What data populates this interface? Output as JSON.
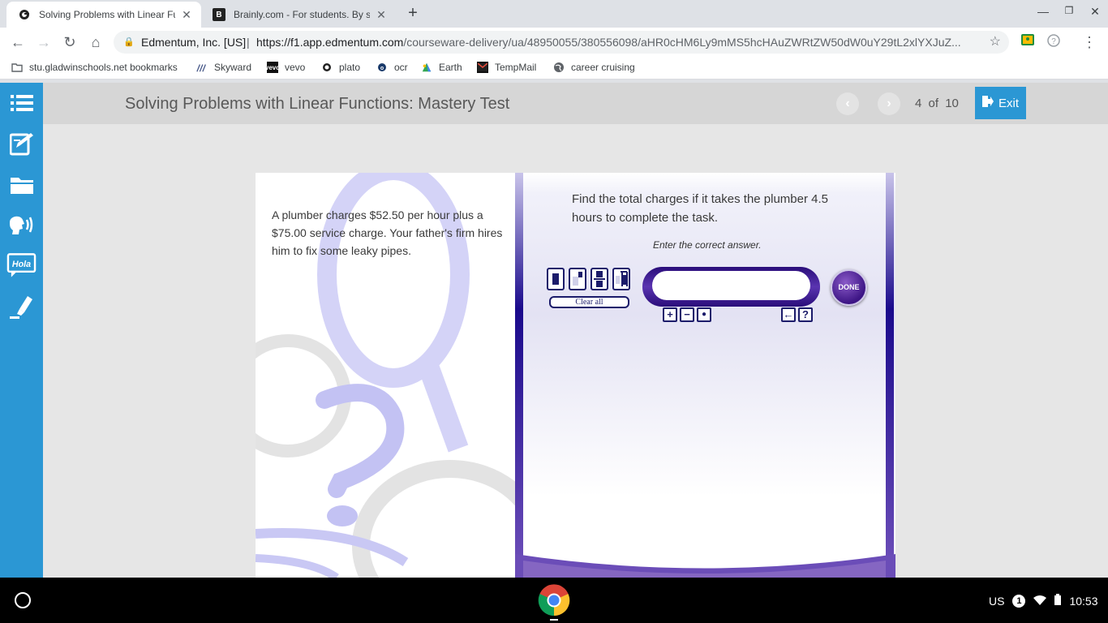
{
  "browser": {
    "tabs": [
      {
        "title": "Solving Problems with Linear Fu",
        "favicon": "edmentum-icon",
        "active": true
      },
      {
        "title": "Brainly.com - For students. By st",
        "favicon": "brainly-icon",
        "active": false
      }
    ],
    "address": {
      "site_name": "Edmentum, Inc. [US]",
      "separator": "|",
      "url_host": "https://f1.app.edmentum.com",
      "url_path": "/courseware-delivery/ua/48950055/380556098/aHR0cHM6Ly9mMS5hcHAuZWRtZW50dW0uY29tL2xlYXJuZ..."
    },
    "bookmarks": [
      {
        "label": "stu.gladwinschools.net bookmarks",
        "icon": "folder-icon"
      },
      {
        "label": "Skyward",
        "icon": "skyward-icon"
      },
      {
        "label": "vevo",
        "icon": "vevo-icon"
      },
      {
        "label": "plato",
        "icon": "edmentum-icon"
      },
      {
        "label": "ocr",
        "icon": "ocr-icon"
      },
      {
        "label": "Earth",
        "icon": "earth-icon"
      },
      {
        "label": "TempMail",
        "icon": "mail-icon"
      },
      {
        "label": "career cruising",
        "icon": "globe-icon"
      }
    ]
  },
  "app": {
    "title": "Solving Problems with Linear Functions: Mastery Test",
    "progress": {
      "current": "4",
      "of": "of",
      "total": "10"
    },
    "exit_label": "Exit",
    "sidebar": [
      "menu-icon",
      "notes-icon",
      "folder-icon",
      "speech-icon",
      "translate-icon",
      "highlighter-icon"
    ],
    "sidebar_translate_label": "Hola"
  },
  "question": {
    "prompt": "A plumber charges $52.50 per hour plus a $75.00 service charge. Your father's firm hires him to fix some leaky pipes.",
    "text": "Find the total charges if it takes the plumber 4.5 hours to complete the task.",
    "instruction": "Enter the correct answer.",
    "answer_value": "",
    "clear_all_label": "Clear all",
    "done_label": "DONE",
    "sign_buttons": [
      "+",
      "−",
      "●"
    ],
    "util_buttons": [
      "←",
      "?"
    ]
  },
  "taskbar": {
    "locale": "US",
    "notification_count": "1",
    "time": "10:53"
  },
  "colors": {
    "sidebar": "#2b97d4",
    "accent_purple": "#3d1585",
    "exit_button": "#2b97d4"
  }
}
